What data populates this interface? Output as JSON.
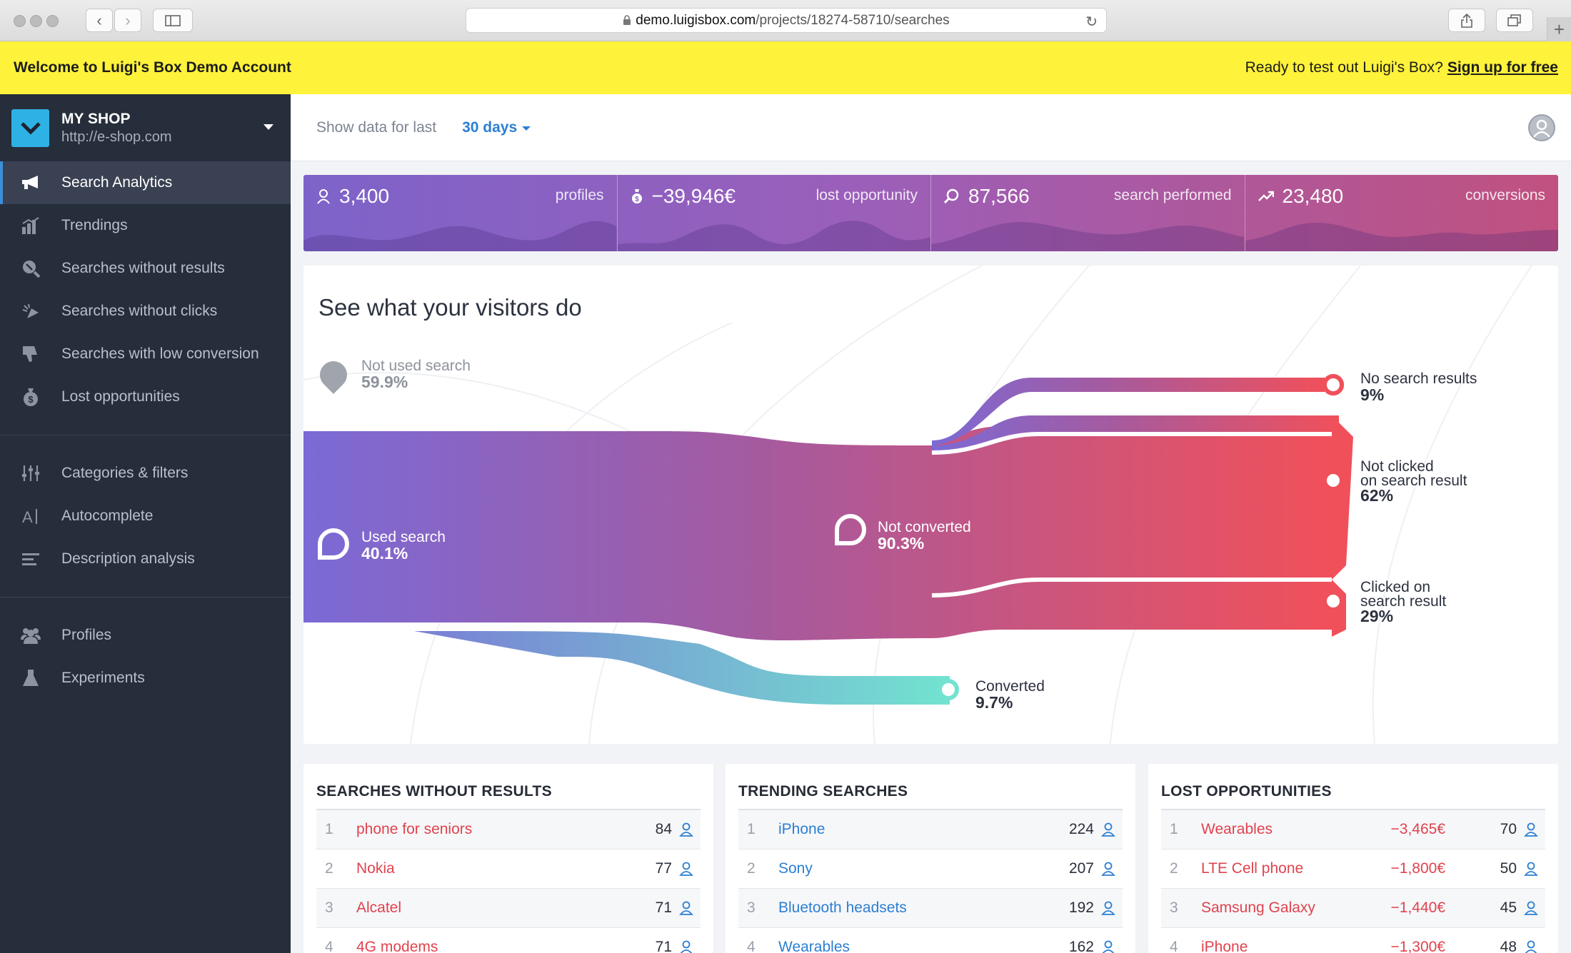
{
  "browser": {
    "url_host": "demo.luigisbox.com",
    "url_path": "/projects/18274-58710/searches"
  },
  "banner": {
    "welcome": "Welcome to Luigi's Box Demo Account",
    "cta_text": "Ready to test out Luigi's Box?",
    "cta_link": "Sign up for free"
  },
  "sidebar": {
    "shop_name": "MY SHOP",
    "shop_url": "http://e-shop.com",
    "items": [
      {
        "label": "Search Analytics",
        "icon": "megaphone-icon"
      },
      {
        "label": "Trendings",
        "icon": "bar-chart-icon"
      },
      {
        "label": "Searches without results",
        "icon": "search-off-icon"
      },
      {
        "label": "Searches without clicks",
        "icon": "cursor-off-icon"
      },
      {
        "label": "Searches with low conversion",
        "icon": "thumbs-down-icon"
      },
      {
        "label": "Lost opportunities",
        "icon": "money-bag-icon"
      },
      {
        "label": "Categories & filters",
        "icon": "sliders-icon"
      },
      {
        "label": "Autocomplete",
        "icon": "autocomplete-icon"
      },
      {
        "label": "Description analysis",
        "icon": "text-lines-icon"
      },
      {
        "label": "Profiles",
        "icon": "users-icon"
      },
      {
        "label": "Experiments",
        "icon": "flask-icon"
      }
    ]
  },
  "header": {
    "show_label": "Show data for last",
    "range": "30 days"
  },
  "kpis": [
    {
      "value": "3,400",
      "label": "profiles",
      "icon": "user-icon"
    },
    {
      "value": "−39,946€",
      "label": "lost opportunity",
      "icon": "money-bag-icon"
    },
    {
      "value": "87,566",
      "label": "search performed",
      "icon": "search-icon"
    },
    {
      "value": "23,480",
      "label": "conversions",
      "icon": "trend-up-icon"
    }
  ],
  "flow": {
    "title": "See what your visitors do",
    "not_used": {
      "label": "Not used search",
      "pct": "59.9%"
    },
    "used": {
      "label": "Used search",
      "pct": "40.1%"
    },
    "not_converted": {
      "label": "Not converted",
      "pct": "90.3%"
    },
    "converted": {
      "label": "Converted",
      "pct": "9.7%"
    },
    "no_results": {
      "label": "No search results",
      "pct": "9%"
    },
    "not_clicked": {
      "label1": "Not clicked",
      "label2": "on search result",
      "pct": "62%"
    },
    "clicked": {
      "label1": "Clicked on",
      "label2": "search result",
      "pct": "29%"
    }
  },
  "cards": {
    "no_results": {
      "title": "SEARCHES WITHOUT RESULTS",
      "rows": [
        {
          "n": "1",
          "name": "phone for seniors",
          "count": "84"
        },
        {
          "n": "2",
          "name": "Nokia",
          "count": "77"
        },
        {
          "n": "3",
          "name": "Alcatel",
          "count": "71"
        },
        {
          "n": "4",
          "name": "4G modems",
          "count": "71"
        }
      ]
    },
    "trending": {
      "title": "TRENDING SEARCHES",
      "rows": [
        {
          "n": "1",
          "name": "iPhone",
          "count": "224"
        },
        {
          "n": "2",
          "name": "Sony",
          "count": "207"
        },
        {
          "n": "3",
          "name": "Bluetooth headsets",
          "count": "192"
        },
        {
          "n": "4",
          "name": "Wearables",
          "count": "162"
        }
      ]
    },
    "lost": {
      "title": "LOST OPPORTUNITIES",
      "rows": [
        {
          "n": "1",
          "name": "Wearables",
          "loss": "−3,465€",
          "count": "70"
        },
        {
          "n": "2",
          "name": "LTE Cell phone",
          "loss": "−1,800€",
          "count": "50"
        },
        {
          "n": "3",
          "name": "Samsung Galaxy",
          "loss": "−1,440€",
          "count": "45"
        },
        {
          "n": "4",
          "name": "iPhone",
          "loss": "−1,300€",
          "count": "48"
        }
      ]
    }
  },
  "colors": {
    "accent_blue": "#2c7fd3",
    "alert_red": "#e0434e",
    "banner_yellow": "#fff23a",
    "sidebar_bg": "#262d3b",
    "flow_purple": "#7b6ad6",
    "flow_red": "#f0505a",
    "flow_teal": "#6fdccf"
  }
}
